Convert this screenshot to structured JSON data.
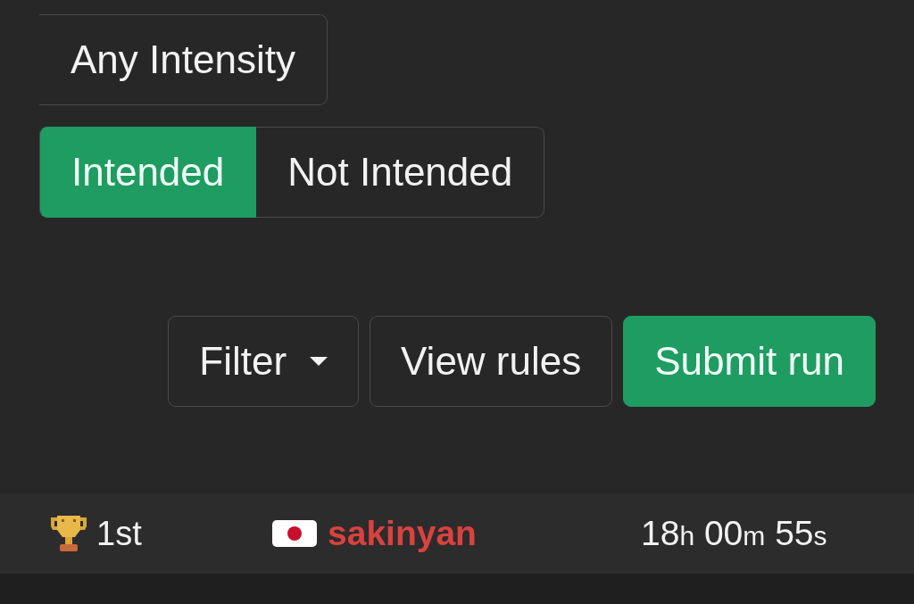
{
  "intensity_filter": [
    {
      "label": "Any Intensity",
      "selected": false
    }
  ],
  "intended_filter": [
    {
      "label": "Intended",
      "selected": true
    },
    {
      "label": "Not Intended",
      "selected": false
    }
  ],
  "actions": [
    {
      "label": "Filter",
      "kind": "dropdown"
    },
    {
      "label": "View rules",
      "kind": "plain"
    },
    {
      "label": "Submit run",
      "kind": "primary"
    }
  ],
  "leaderboard": {
    "rows": [
      {
        "rank": "1st",
        "player": "sakinyan",
        "color": "#d9423f",
        "time": [
          {
            "value": "18",
            "unit": "h"
          },
          {
            "value": "00",
            "unit": "m"
          },
          {
            "value": "55",
            "unit": "s"
          }
        ]
      }
    ]
  }
}
